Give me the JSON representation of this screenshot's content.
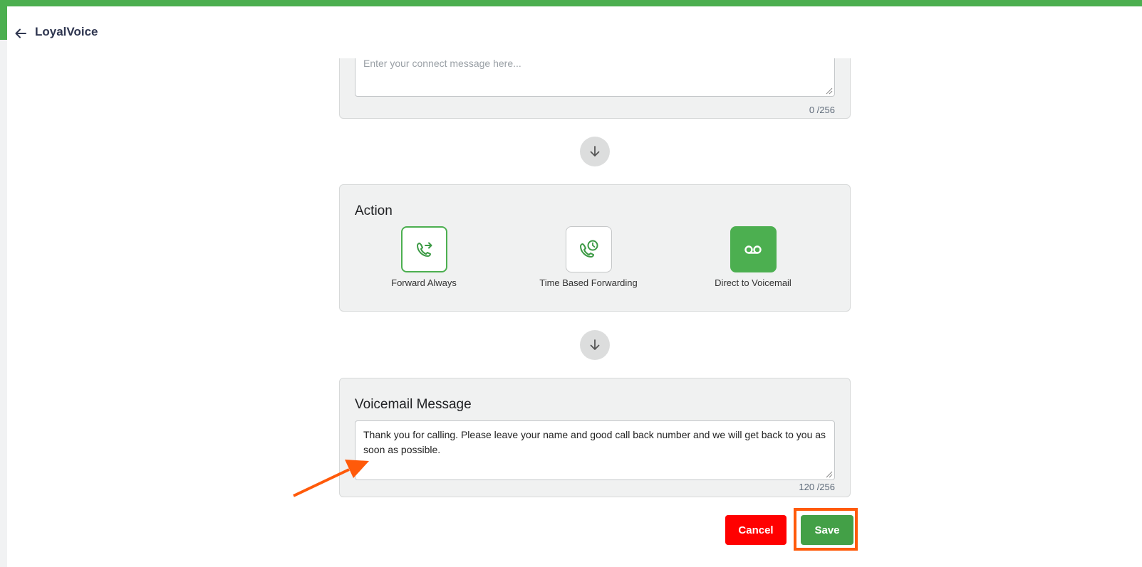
{
  "header": {
    "app_title": "LoyalVoice"
  },
  "connect_card": {
    "placeholder": "Enter your connect message here...",
    "counter": "0 /256"
  },
  "action_card": {
    "title": "Action",
    "options": [
      {
        "label": "Forward Always",
        "icon": "phone-forward-icon",
        "state": "outlined"
      },
      {
        "label": "Time Based Forwarding",
        "icon": "phone-clock-icon",
        "state": "default"
      },
      {
        "label": "Direct to Voicemail",
        "icon": "voicemail-icon",
        "state": "selected"
      }
    ]
  },
  "voicemail_card": {
    "title": "Voicemail Message",
    "message": "Thank you for calling. Please leave your name and good call back number and we will get back to you as soon as possible.",
    "counter": "120 /256"
  },
  "buttons": {
    "cancel": "Cancel",
    "save": "Save"
  },
  "colors": {
    "brand_green": "#4caf50",
    "cancel_red": "#ff0000",
    "save_green": "#43a047",
    "annotation_orange": "#ff5a0a"
  }
}
